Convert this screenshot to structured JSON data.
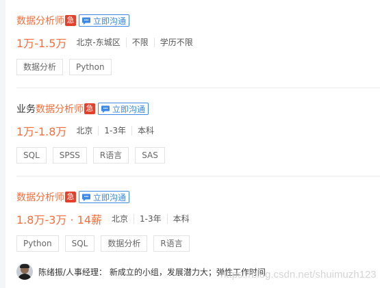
{
  "jobs": [
    {
      "title_prefix": "",
      "title_highlight": "数据分析师",
      "urgent": "急",
      "chat_label": "立即沟通",
      "salary": "1万-1.5万",
      "meta": [
        "北京-东城区",
        "不限",
        "学历不限"
      ],
      "tags": [
        "数据分析",
        "Python"
      ]
    },
    {
      "title_prefix": "业务",
      "title_highlight": "数据分析师",
      "urgent": "急",
      "chat_label": "立即沟通",
      "salary": "1万-1.8万",
      "meta": [
        "北京",
        "1-3年",
        "本科"
      ],
      "tags": [
        "SQL",
        "SPSS",
        "R语言",
        "SAS"
      ]
    },
    {
      "title_prefix": "",
      "title_highlight": "数据分析师",
      "urgent": "急",
      "chat_label": "立即沟通",
      "salary": "1.8万-3万 · 14薪",
      "meta": [
        "北京",
        "1-3年",
        "本科"
      ],
      "tags": [
        "Python",
        "SQL",
        "数据分析",
        "R语言"
      ]
    }
  ],
  "recruiter": {
    "text": "陈绪振/人事经理： 新成立的小组，发展潜力大；弹性工作时间"
  },
  "watermark": "https://blog.csdn.net/shuimuzh123",
  "icons": {
    "chat": "chat-bubble-icon",
    "avatar": "recruiter-avatar"
  },
  "colors": {
    "highlight": "#fc6c38",
    "urgent": "#e5402b",
    "chat": "#3d89e6"
  }
}
